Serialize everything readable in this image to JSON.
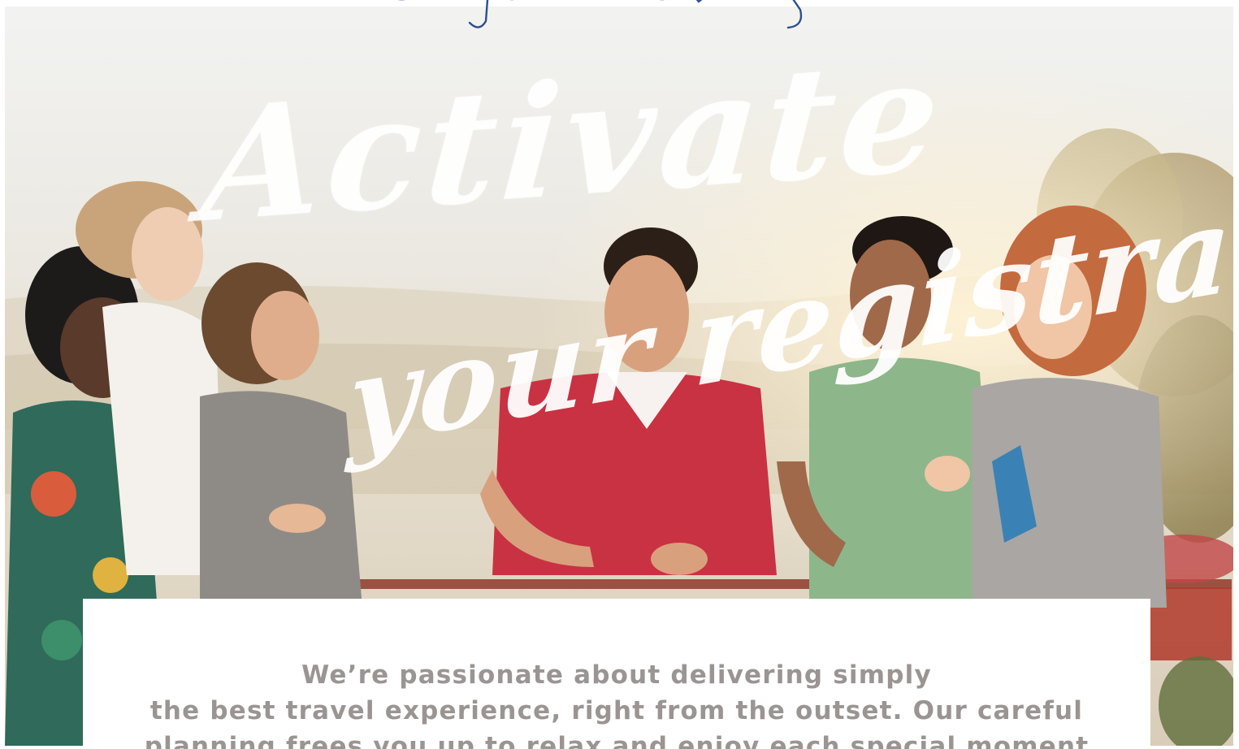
{
  "handwritten_note": "Bam forgot to do this",
  "headline": {
    "line1": "Activate",
    "line2": "your registration"
  },
  "body": {
    "lines": [
      "We’re passionate about delivering simply",
      "the best travel experience, right from the outset. Our careful",
      "planning frees you up to relax and enjoy each special moment"
    ]
  },
  "colors": {
    "ink_blue": "#2c4e93",
    "headline_white": "#ffffff",
    "body_text": "#9a9592"
  }
}
